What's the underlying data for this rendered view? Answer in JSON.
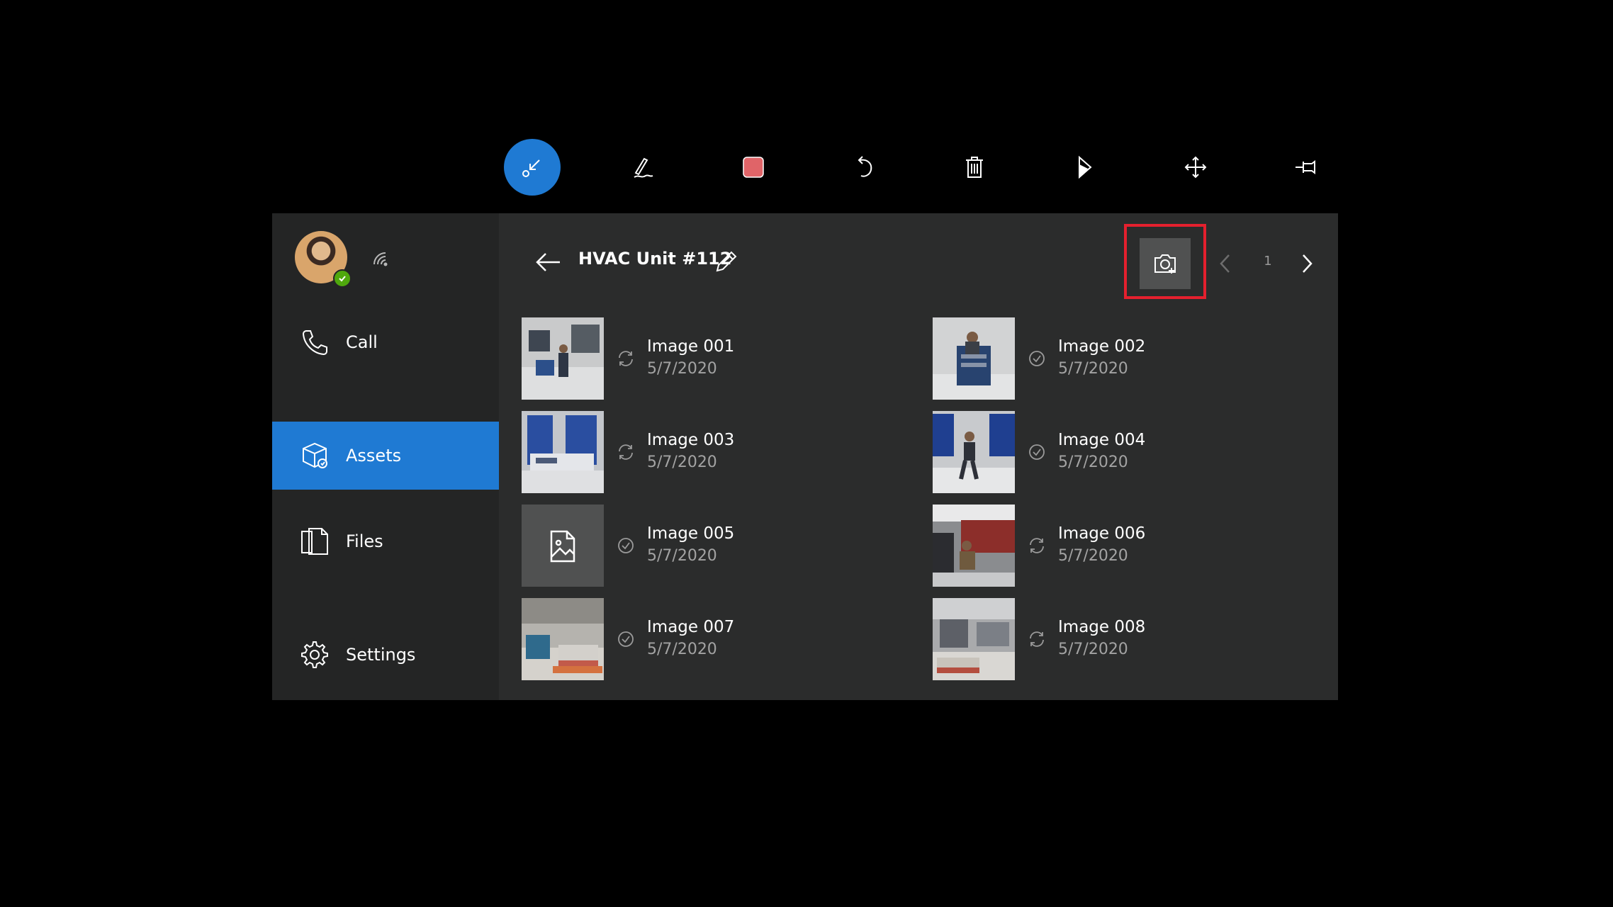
{
  "toolbar": {
    "tools": [
      {
        "name": "minimize",
        "icon": "minimize-icon",
        "active": true
      },
      {
        "name": "ink",
        "icon": "pen-icon"
      },
      {
        "name": "color",
        "icon": "color-swatch-icon",
        "color": "#e06468"
      },
      {
        "name": "undo",
        "icon": "undo-icon"
      },
      {
        "name": "delete",
        "icon": "trash-icon"
      },
      {
        "name": "dynamics",
        "icon": "dynamics-logo-icon"
      },
      {
        "name": "move",
        "icon": "move-icon"
      },
      {
        "name": "pin",
        "icon": "pin-icon"
      }
    ]
  },
  "sidebar": {
    "items": [
      {
        "label": "Call",
        "icon": "phone-icon"
      },
      {
        "label": "Assets",
        "icon": "assets-box-icon",
        "active": true
      },
      {
        "label": "Files",
        "icon": "files-icon"
      },
      {
        "label": "Settings",
        "icon": "gear-icon"
      }
    ]
  },
  "header": {
    "title": "HVAC Unit #112",
    "page": "1"
  },
  "assets": [
    {
      "name": "Image 001",
      "date": "5/7/2020",
      "status": "syncing"
    },
    {
      "name": "Image 002",
      "date": "5/7/2020",
      "status": "synced"
    },
    {
      "name": "Image 003",
      "date": "5/7/2020",
      "status": "syncing"
    },
    {
      "name": "Image 004",
      "date": "5/7/2020",
      "status": "synced"
    },
    {
      "name": "Image 005",
      "date": "5/7/2020",
      "status": "synced"
    },
    {
      "name": "Image 006",
      "date": "5/7/2020",
      "status": "syncing"
    },
    {
      "name": "Image 007",
      "date": "5/7/2020",
      "status": "synced"
    },
    {
      "name": "Image 008",
      "date": "5/7/2020",
      "status": "syncing"
    }
  ],
  "colors": {
    "accent": "#1f7ad3",
    "highlight": "#e5202e",
    "presence": "#4fa80d",
    "swatch": "#e06468"
  }
}
